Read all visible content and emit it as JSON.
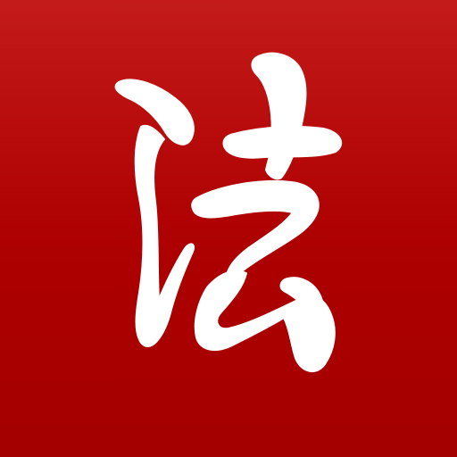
{
  "app_icon": {
    "glyph": "法",
    "glyph_color": "#ffffff",
    "background_color": "#b00000"
  }
}
